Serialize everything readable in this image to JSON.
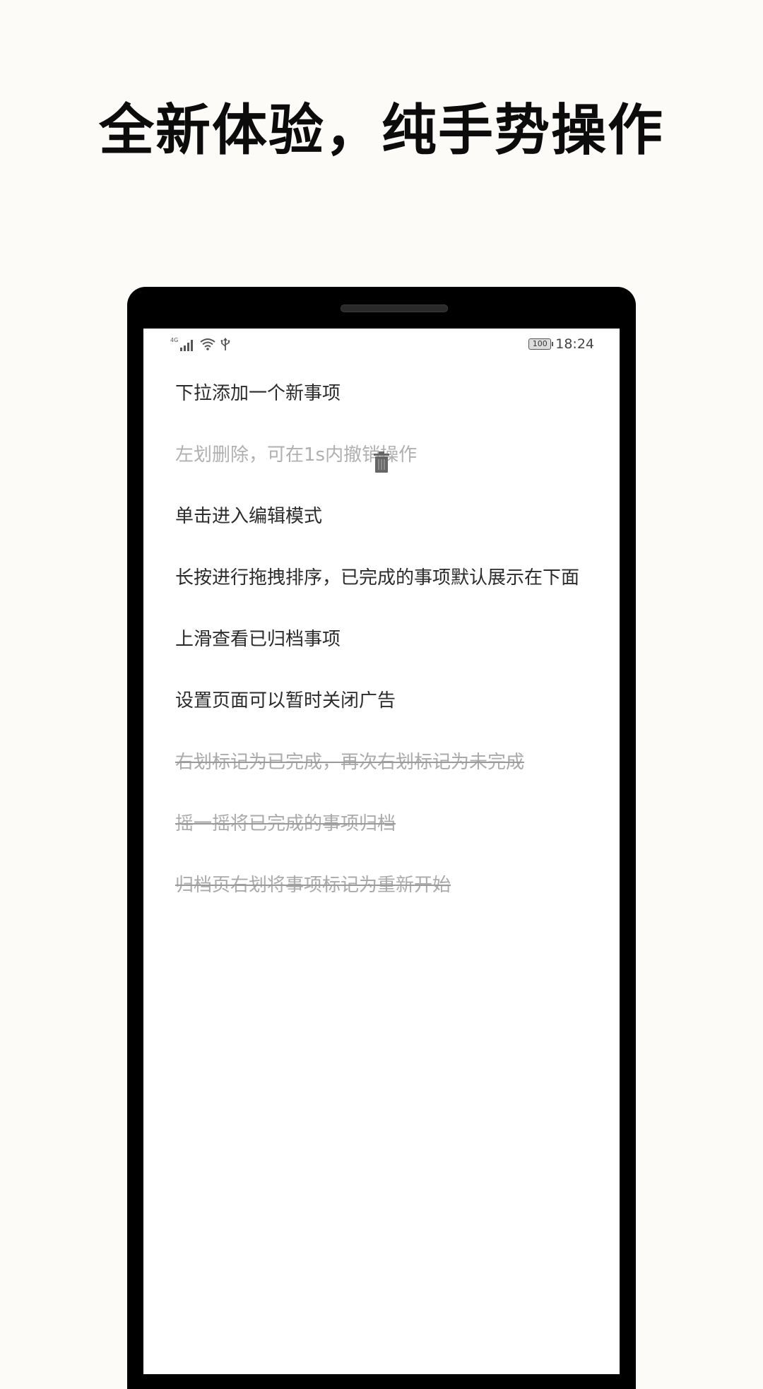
{
  "headline": "全新体验，纯手势操作",
  "status_bar": {
    "network": "4G",
    "battery": "100",
    "time": "18:24"
  },
  "tasks": [
    {
      "text": "下拉添加一个新事项",
      "state": "normal"
    },
    {
      "text": "左划删除，可在1s内撤销操作",
      "state": "deleting"
    },
    {
      "text": "单击进入编辑模式",
      "state": "normal"
    },
    {
      "text": "长按进行拖拽排序，已完成的事项默认展示在下面",
      "state": "normal"
    },
    {
      "text": "上滑查看已归档事项",
      "state": "normal"
    },
    {
      "text": "设置页面可以暂时关闭广告",
      "state": "normal"
    },
    {
      "text": "右划标记为已完成，再次右划标记为未完成",
      "state": "completed"
    },
    {
      "text": "摇一摇将已完成的事项归档",
      "state": "completed"
    },
    {
      "text": "归档页右划将事项标记为重新开始",
      "state": "completed"
    }
  ],
  "colors": {
    "page_background": "#fdfbf8",
    "phone_frame": "#000000",
    "text_active": "#2b2b2b",
    "text_completed": "#aaaaaa",
    "trash_icon": "#666666"
  },
  "icons": [
    "signal-icon",
    "wifi-icon",
    "usb-icon",
    "battery-icon",
    "trash-icon"
  ]
}
